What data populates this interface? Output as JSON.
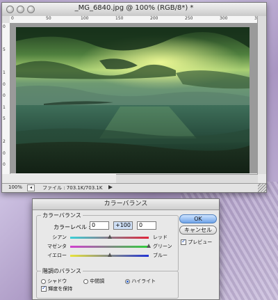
{
  "document": {
    "title": "_MG_6840.jpg @ 100% (RGB/8*) *",
    "zoom": "100%",
    "file_info": "ファイル : 703.1K/703.1K",
    "ruler_h": [
      "0",
      "",
      "",
      "",
      "50",
      "",
      "",
      "",
      "100",
      "",
      "",
      "",
      "150",
      "",
      "",
      "",
      "200",
      "",
      "",
      "",
      "250",
      "",
      "",
      "",
      "300",
      "",
      "",
      "",
      "350"
    ],
    "ruler_v": [
      "0",
      "",
      "5",
      "",
      "1",
      "0",
      "0",
      "1",
      "5",
      "",
      "2",
      "0",
      "0"
    ]
  },
  "dialog": {
    "title": "カラーバランス",
    "color_balance_group": "カラーバランス",
    "color_level_label": "カラーレベル :",
    "levels": [
      "0",
      "+100",
      "0"
    ],
    "sliders": [
      {
        "left": "シアン",
        "right": "レッド",
        "gradient_from": "#3ad0d8",
        "gradient_to": "#e0243a",
        "value": 0
      },
      {
        "left": "マゼンタ",
        "right": "グリーン",
        "gradient_from": "#d23fd0",
        "gradient_to": "#2fcf3a",
        "value": 100
      },
      {
        "left": "イエロー",
        "right": "ブルー",
        "gradient_from": "#e8e43a",
        "gradient_to": "#2233d4",
        "value": 0
      }
    ],
    "tone_group": "階調のバランス",
    "tones": [
      {
        "label": "シャドウ",
        "selected": false
      },
      {
        "label": "中間調",
        "selected": false
      },
      {
        "label": "ハイライト",
        "selected": true
      }
    ],
    "preserve_luminosity": {
      "label": "輝度を保持",
      "checked": true
    },
    "ok_label": "OK",
    "cancel_label": "キャンセル",
    "preview": {
      "label": "プレビュー",
      "checked": true
    }
  }
}
